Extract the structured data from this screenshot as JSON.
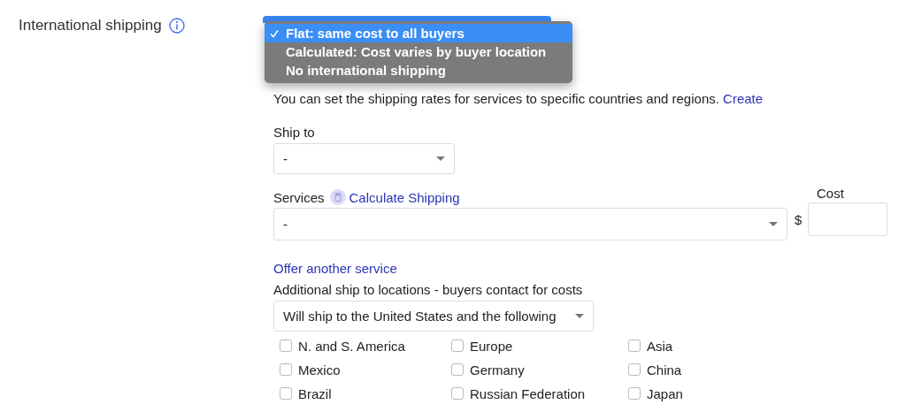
{
  "field_label": "International shipping",
  "menu": {
    "options": [
      {
        "label": "Flat: same cost to all buyers",
        "selected": true
      },
      {
        "label": "Calculated: Cost varies by buyer location",
        "selected": false
      },
      {
        "label": "No international shipping",
        "selected": false
      }
    ]
  },
  "intro": {
    "text": "You can set the shipping rates for services to specific countries and regions.",
    "link": "Create"
  },
  "ship_to": {
    "label": "Ship to",
    "value": "-"
  },
  "services": {
    "label": "Services",
    "link": "Calculate Shipping",
    "value": "-"
  },
  "cost": {
    "label": "Cost",
    "currency": "$"
  },
  "offer_link": "Offer another service",
  "additional": {
    "label": "Additional ship to locations - buyers contact for costs",
    "value": "Will ship to the United States and the following"
  },
  "locations": [
    {
      "label": "N. and S. America",
      "checked": false
    },
    {
      "label": "Europe",
      "checked": false
    },
    {
      "label": "Asia",
      "checked": false
    },
    {
      "label": "Mexico",
      "checked": false
    },
    {
      "label": "Germany",
      "checked": false
    },
    {
      "label": "China",
      "checked": false
    },
    {
      "label": "Brazil",
      "checked": false
    },
    {
      "label": "Russian Federation",
      "checked": false
    },
    {
      "label": "Japan",
      "checked": false
    }
  ]
}
